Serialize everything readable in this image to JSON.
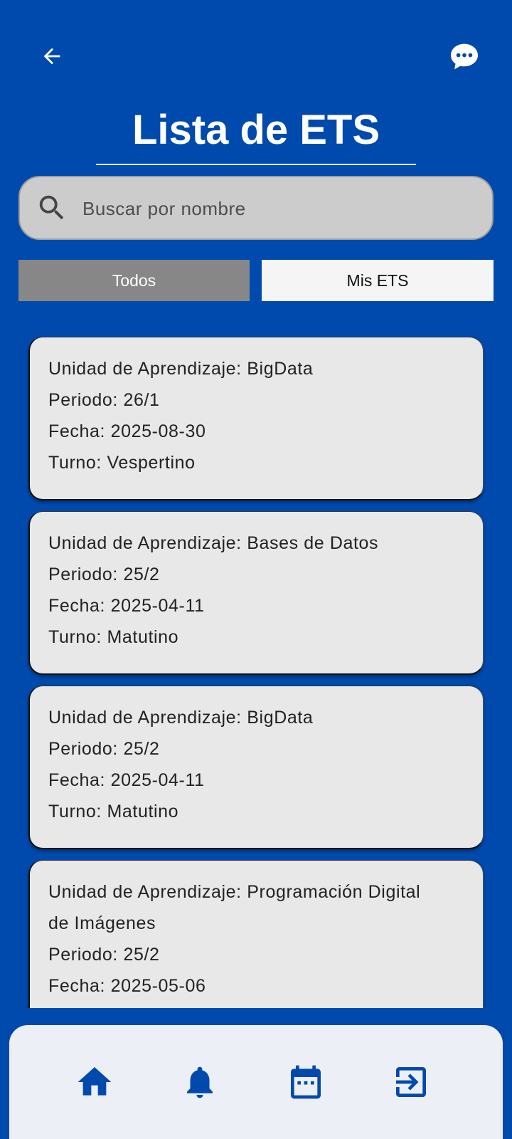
{
  "header": {
    "title": "Lista de ETS",
    "back_icon": "arrow-left-icon",
    "chat_icon": "chat-bubble-icon"
  },
  "search": {
    "placeholder": "Buscar por nombre",
    "value": ""
  },
  "tabs": [
    {
      "label": "Todos",
      "selected": true
    },
    {
      "label": "Mis ETS",
      "selected": false
    }
  ],
  "ets_list": [
    {
      "unidad": "Unidad de Aprendizaje: BigData",
      "periodo": "Periodo: 26/1",
      "fecha": "Fecha: 2025-08-30",
      "turno": "Turno: Vespertino"
    },
    {
      "unidad": "Unidad de Aprendizaje: Bases de Datos",
      "periodo": "Periodo: 25/2",
      "fecha": "Fecha: 2025-04-11",
      "turno": "Turno: Matutino"
    },
    {
      "unidad": "Unidad de Aprendizaje: BigData",
      "periodo": "Periodo: 25/2",
      "fecha": "Fecha: 2025-04-11",
      "turno": "Turno: Matutino"
    },
    {
      "unidad_line1": "Unidad de Aprendizaje: Programación Digital",
      "unidad_line2": "de Imágenes",
      "periodo": "Periodo: 25/2",
      "fecha": "Fecha: 2025-05-06"
    }
  ],
  "bottom_nav": {
    "items": [
      {
        "icon": "home-icon"
      },
      {
        "icon": "bell-icon"
      },
      {
        "icon": "calendar-icon"
      },
      {
        "icon": "logout-icon"
      }
    ]
  },
  "colors": {
    "background": "#014aad",
    "card": "#e8e8e8",
    "tab_selected": "#878787",
    "tab_unselected": "#f5f5f5",
    "nav_bar": "#eceff6",
    "nav_icon": "#014aad"
  }
}
